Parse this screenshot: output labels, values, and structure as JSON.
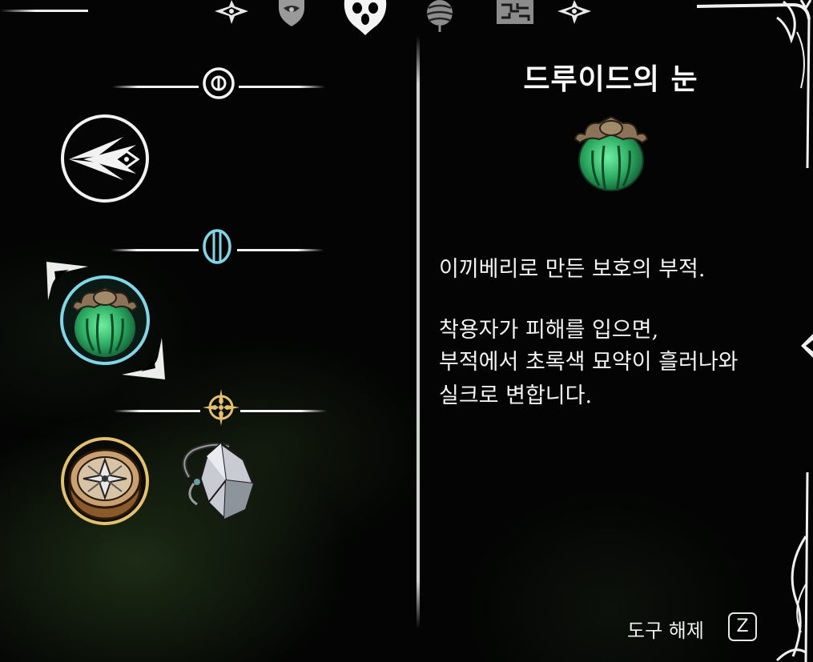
{
  "top_tabs": [
    {
      "name": "diamond-tab-left",
      "icon": "diamond-sigil-icon"
    },
    {
      "name": "mask-tab",
      "icon": "mask-icon"
    },
    {
      "name": "tools-tab",
      "icon": "skull-crest-icon",
      "selected": true
    },
    {
      "name": "globe-tab",
      "icon": "globe-icon"
    },
    {
      "name": "map-tab",
      "icon": "map-icon"
    },
    {
      "name": "diamond-tab-right",
      "icon": "diamond-sigil-icon"
    }
  ],
  "sections": [
    {
      "name": "silk-skills",
      "icon": "circle-rune-icon",
      "color": "#ffffff",
      "items": [
        {
          "name": "silk-spear-skill",
          "icon": "silk-spear-icon"
        }
      ]
    },
    {
      "name": "defensive-tools",
      "icon": "blue-rune-icon",
      "color": "#7fd6e6",
      "items": [
        {
          "name": "druid-eye-tool",
          "icon": "druid-eye-icon",
          "selected": true
        }
      ]
    },
    {
      "name": "explore-tools",
      "icon": "gold-compass-icon",
      "color": "#e3c06a",
      "items": [
        {
          "name": "compass-tool",
          "icon": "compass-icon",
          "equipped": true
        },
        {
          "name": "shard-pendant-tool",
          "icon": "shard-pendant-icon"
        }
      ]
    }
  ],
  "detail": {
    "title": "드루이드의 눈",
    "icon": "druid-eye-icon",
    "description": [
      "이끼베리로 만든 보호의 부적.",
      "착용자가 피해를 입으면,",
      "부적에서 초록색 묘약이 흘러나와",
      "실크로 변합니다."
    ]
  },
  "controls": {
    "unequip_label": "도구 해제",
    "unequip_key": "Z"
  },
  "colors": {
    "background": "#030403",
    "text": "#f3f3f3",
    "selection_ring": "#7fd6e6",
    "equipped_ring": "#e3c06a",
    "druid_green": "#3fcf7a"
  }
}
